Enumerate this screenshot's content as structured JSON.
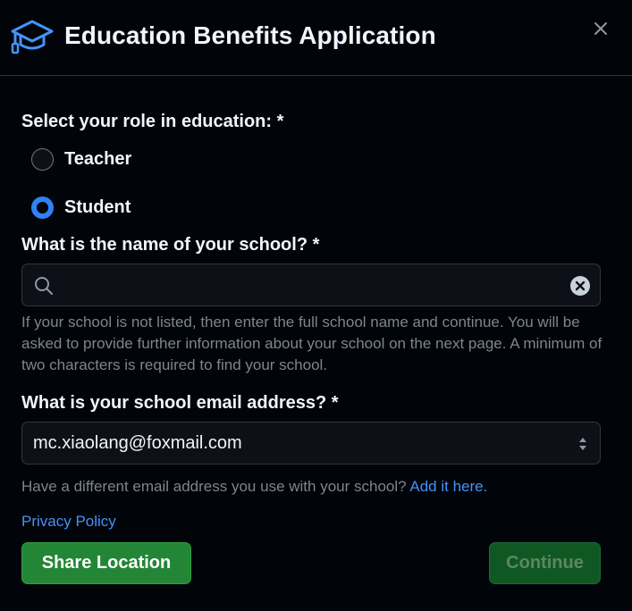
{
  "dialog": {
    "title": "Education Benefits Application",
    "icon": "graduation-cap-icon",
    "close_icon": "close-icon"
  },
  "role": {
    "label": "Select your role in education: *",
    "options": [
      {
        "label": "Teacher",
        "checked": false
      },
      {
        "label": "Student",
        "checked": true
      }
    ]
  },
  "school": {
    "label": "What is the name of your school? *",
    "value": "",
    "placeholder": "",
    "search_icon": "search-icon",
    "clear_icon": "clear-icon",
    "hint": "If your school is not listed, then enter the full school name and continue. You will be asked to provide further information about your school on the next page. A minimum of two characters is required to find your school."
  },
  "email": {
    "label": "What is your school email address? *",
    "selected": "mc.xiaolang@foxmail.com",
    "alt_text": "Have a different email address you use with your school?",
    "alt_link": "Add it here."
  },
  "footer": {
    "privacy": "Privacy Policy",
    "share_label": "Share Location",
    "continue_label": "Continue"
  },
  "colors": {
    "background": "#010409",
    "accent_blue": "#2f81f7",
    "link": "#4493f8",
    "primary_green": "#238636",
    "disabled_green": "#105823"
  }
}
